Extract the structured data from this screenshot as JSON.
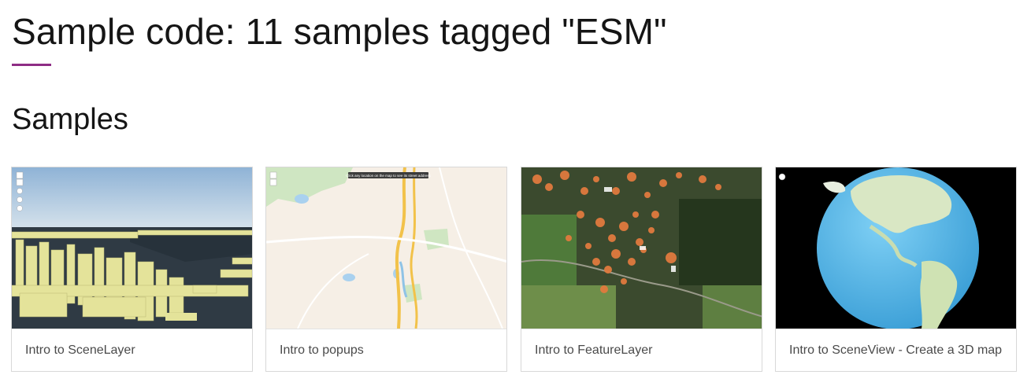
{
  "header": {
    "title": "Sample code: 11 samples tagged \"ESM\"",
    "accent_color": "#8e2d85"
  },
  "section": {
    "title": "Samples"
  },
  "samples": [
    {
      "title": "Intro to SceneLayer",
      "thumbnail": "3d-city-buildings"
    },
    {
      "title": "Intro to popups",
      "thumbnail": "street-map"
    },
    {
      "title": "Intro to FeatureLayer",
      "thumbnail": "satellite-trees"
    },
    {
      "title": "Intro to SceneView - Create a 3D map",
      "thumbnail": "globe"
    }
  ],
  "map_overlays": {
    "popup_hint": "Click any location on the map to see its street address"
  }
}
